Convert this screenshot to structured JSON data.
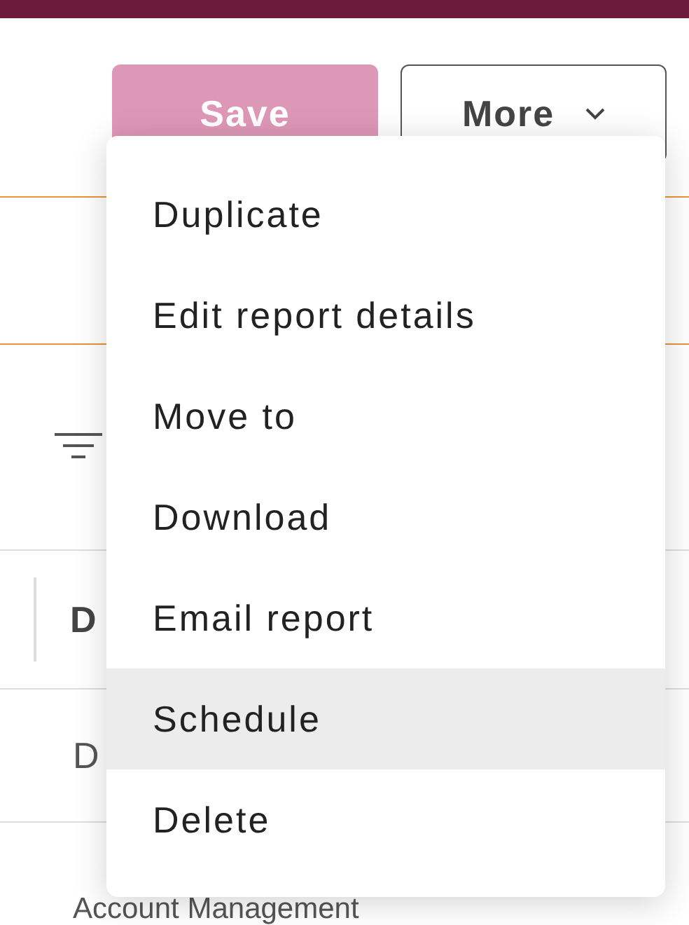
{
  "header": {
    "save_button": "Save",
    "more_button": "More"
  },
  "table": {
    "header_cell": "D",
    "rows": [
      "D",
      "Account Management"
    ]
  },
  "menu": {
    "items": [
      {
        "label": "Duplicate",
        "selected": false
      },
      {
        "label": "Edit report details",
        "selected": false
      },
      {
        "label": "Move to",
        "selected": false
      },
      {
        "label": "Download",
        "selected": false
      },
      {
        "label": "Email report",
        "selected": false
      },
      {
        "label": "Schedule",
        "selected": true
      },
      {
        "label": "Delete",
        "selected": false
      }
    ]
  }
}
